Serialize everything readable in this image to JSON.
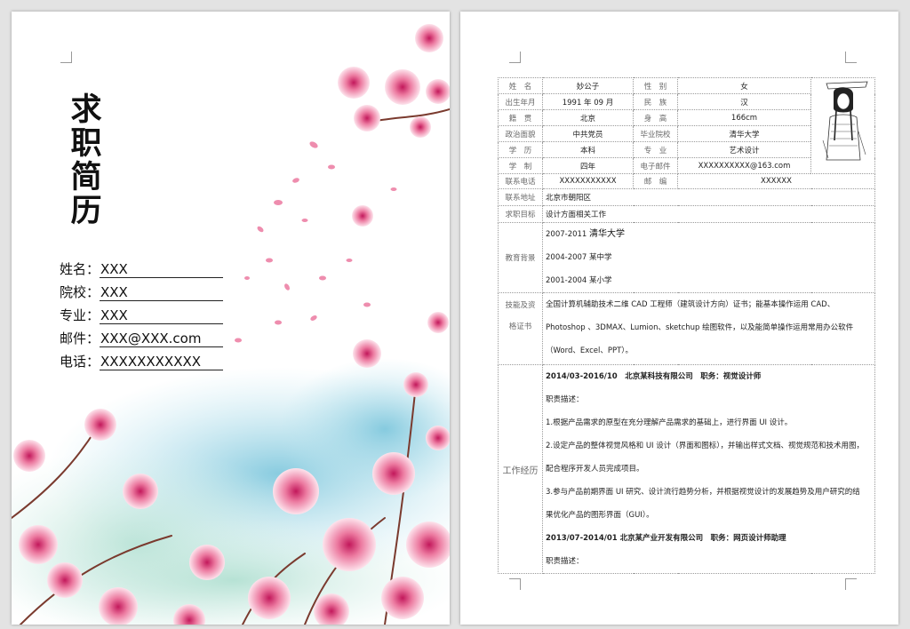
{
  "cover": {
    "title": "求职简历",
    "fields": [
      {
        "label": "姓名：",
        "value": "XXX"
      },
      {
        "label": "院校：",
        "value": "XXX"
      },
      {
        "label": "专业：",
        "value": "XXX"
      },
      {
        "label": "邮件：",
        "value": "XXX@XXX.com"
      },
      {
        "label": "电话：",
        "value": "XXXXXXXXXXX"
      }
    ]
  },
  "resume": {
    "name_label": "姓　名",
    "name": "妙公子",
    "gender_label": "性　别",
    "gender": "女",
    "birth_label": "出生年月",
    "birth": "1991 年 09 月",
    "ethnic_label": "民　族",
    "ethnic": "汉",
    "origin_label": "籍　贯",
    "origin": "北京",
    "height_label": "身　高",
    "height": "166cm",
    "political_label": "政治面貌",
    "political": "中共党员",
    "school_label": "毕业院校",
    "school": "清华大学",
    "degree_label": "学　历",
    "degree": "本科",
    "major_label": "专　业",
    "major": "艺术设计",
    "duration_label": "学　制",
    "duration": "四年",
    "email_label": "电子邮件",
    "email": "XXXXXXXXXX@163.com",
    "phone_label": "联系电话",
    "phone": "XXXXXXXXXXX",
    "zip_label": "邮　编",
    "zip": "XXXXXX",
    "address_label": "联系地址",
    "address": "北京市朝阳区",
    "goal_label": "求职目标",
    "goal": "设计方面相关工作",
    "edu_label": "教育背景",
    "education": [
      {
        "years": "2007-2011",
        "school": "清华大学"
      },
      {
        "years": "2004-2007",
        "school": "某中学"
      },
      {
        "years": "2001-2004",
        "school": "某小学"
      }
    ],
    "skills_label_1": "技能及资",
    "skills_label_2": "格证书",
    "skills_1": "全国计算机辅助技术二维 CAD 工程师（建筑设计方向）证书；能基本操作运用 CAD、",
    "skills_2": "Photoshop 、3DMAX、Lumion、sketchup 绘图软件，以及能简单操作运用常用办公软件",
    "skills_3": "（Word、Excel、PPT）。",
    "work_label": "工作经历",
    "job1_header": "2014/03-2016/10　北京某科技有限公司　职务：视觉设计师",
    "job1_desc_title": "职责描述：",
    "job1_items": [
      "1.根据产品需求的原型在充分理解产品需求的基础上，进行界面 UI 设计。",
      "2.设定产品的整体视觉风格和 UI 设计（界面和图标），并输出样式文档、视觉规范和技术用图，",
      "配合程序开发人员完成项目。",
      "3.参与产品前期界面 UI 研究、设计流行趋势分析，并根据视觉设计的发展趋势及用户研究的结",
      "果优化产品的图形界面（GUI）。"
    ],
    "job2_header": "2013/07-2014/01 北京某产业开发有限公司　职务：网页设计师助理",
    "job2_desc_title": "职责描述："
  },
  "colors": {
    "petal": "#e8799c",
    "petal_light": "#f6c4d3",
    "wash": "#8fcfe0",
    "branch": "#7a3a2e"
  }
}
